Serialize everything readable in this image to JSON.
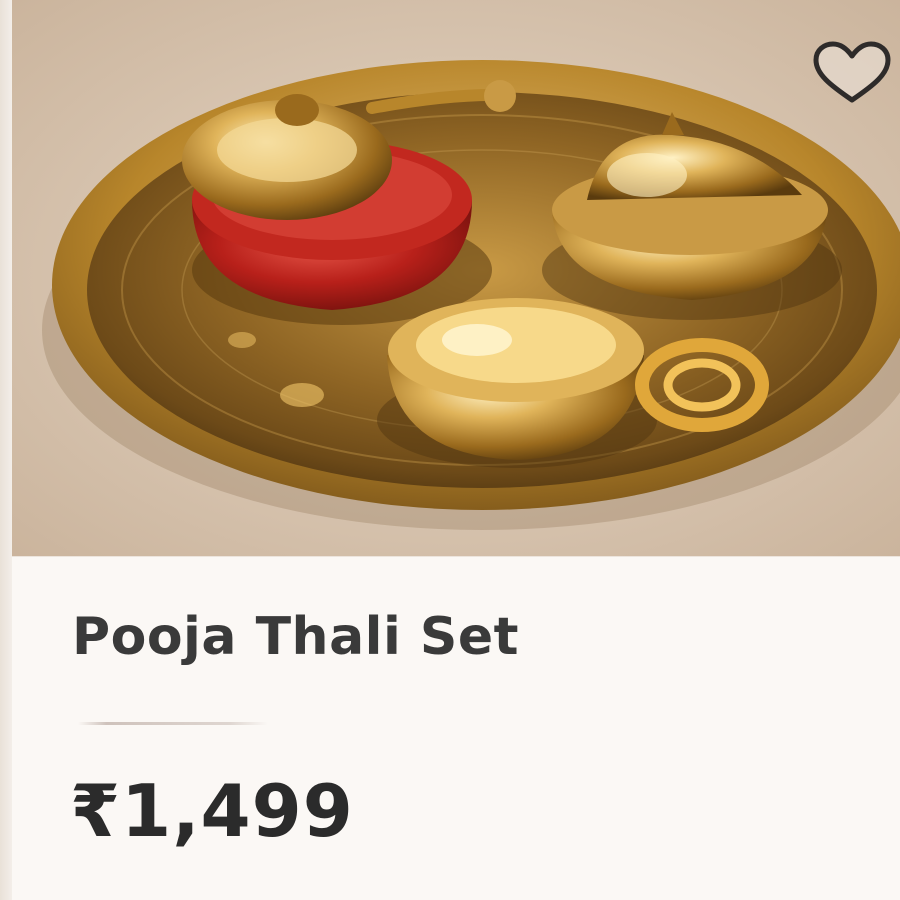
{
  "product": {
    "name": "Pooja Thali Set",
    "price": "₹1,499",
    "image_subject": "Pooja Thali Set product photo"
  },
  "actions": {
    "wishlist_icon": "heart-outline-icon"
  },
  "colors": {
    "card_background": "#fbf8f5",
    "title_text": "#3a3a3a",
    "price_text": "#2b2b2b",
    "brass": "#b8862b",
    "kumkum_red": "#b8201a"
  }
}
